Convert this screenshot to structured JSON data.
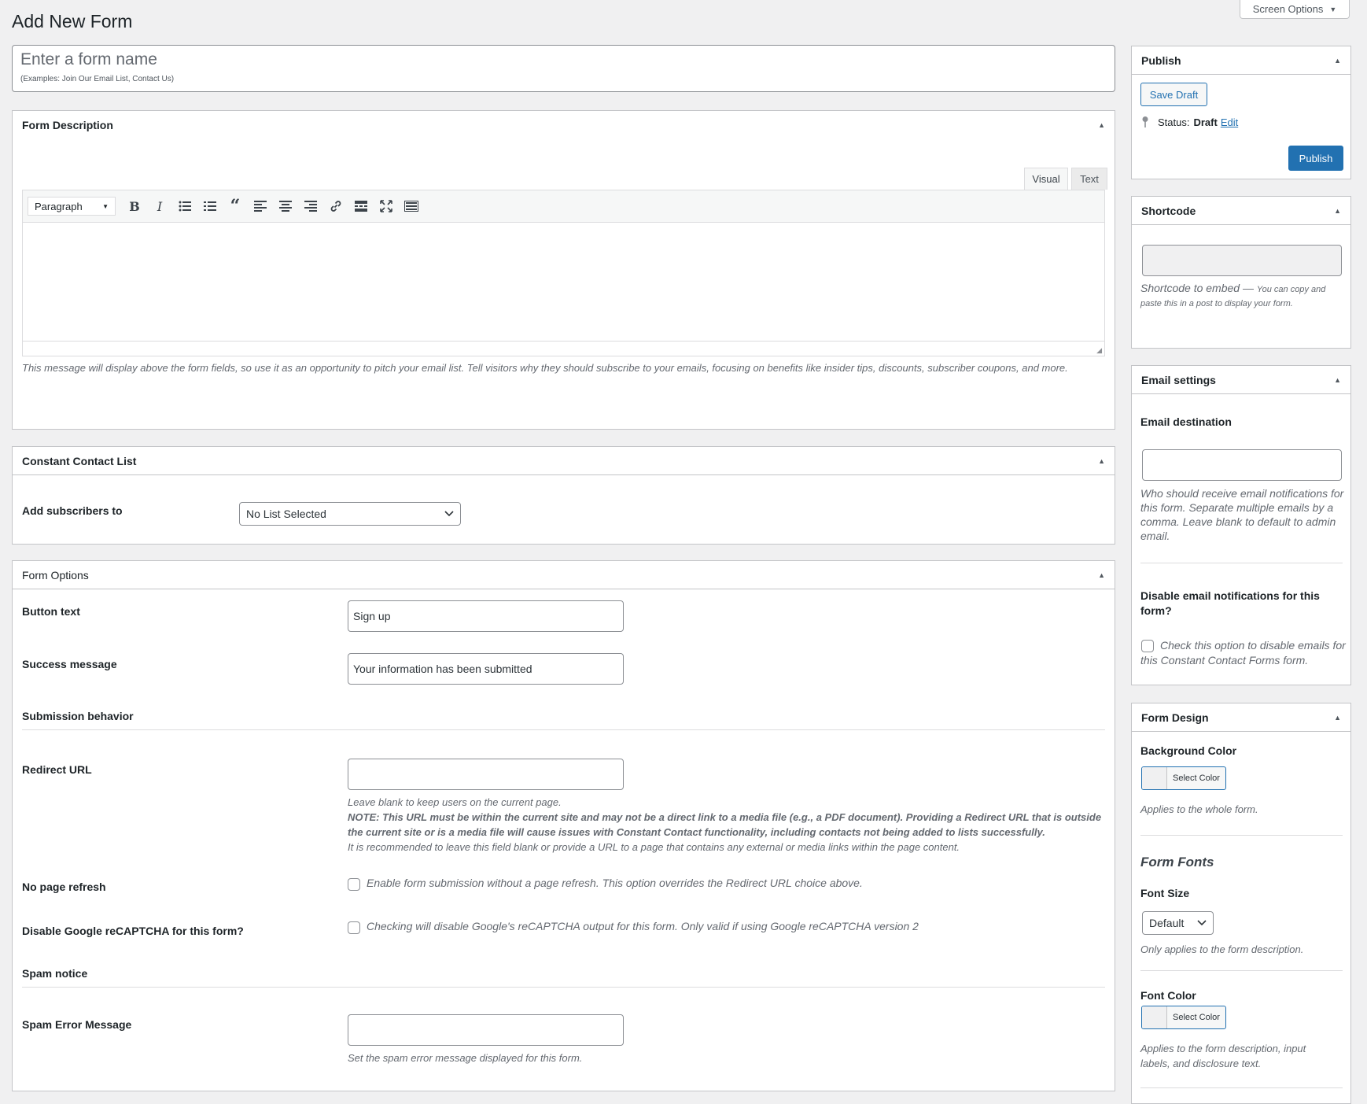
{
  "page": {
    "title": "Add New Form",
    "screen_options": "Screen Options"
  },
  "form_name": {
    "placeholder": "Enter a form name",
    "hint": "(Examples: Join Our Email List, Contact Us)"
  },
  "description_box": {
    "title": "Form Description",
    "tab_visual": "Visual",
    "tab_text": "Text",
    "format_select": "Paragraph",
    "help": "This message will display above the form fields, so use it as an opportunity to pitch your email list. Tell visitors why they should subscribe to your emails, focusing on benefits like insider tips, discounts, subscriber coupons, and more."
  },
  "list_box": {
    "title": "Constant Contact List",
    "label": "Add subscribers to",
    "select_value": "No List Selected"
  },
  "options_box": {
    "title": "Form Options",
    "button_text_label": "Button text",
    "button_text_value": "Sign up",
    "success_label": "Success message",
    "success_value": "Your information has been submitted",
    "submission_heading": "Submission behavior",
    "redirect_label": "Redirect URL",
    "redirect_help1": "Leave blank to keep users on the current page.",
    "redirect_help2": "NOTE: This URL must be within the current site and may not be a direct link to a media file (e.g., a PDF document). Providing a Redirect URL that is outside the current site or is a media file will cause issues with Constant Contact functionality, including contacts not being added to lists successfully.",
    "redirect_help3": "It is recommended to leave this field blank or provide a URL to a page that contains any external or media links within the page content.",
    "no_refresh_label": "No page refresh",
    "no_refresh_desc": "Enable form submission without a page refresh. This option overrides the Redirect URL choice above.",
    "recaptcha_label": "Disable Google reCAPTCHA for this form?",
    "recaptcha_desc": "Checking will disable Google's reCAPTCHA output for this form. Only valid if using Google reCAPTCHA version 2",
    "spam_heading": "Spam notice",
    "spam_label": "Spam Error Message",
    "spam_help": "Set the spam error message displayed for this form."
  },
  "publish_box": {
    "title": "Publish",
    "save_draft": "Save Draft",
    "status_label": "Status:",
    "status_value": "Draft",
    "edit_link": "Edit",
    "publish_button": "Publish"
  },
  "shortcode_box": {
    "title": "Shortcode",
    "help_lead": "Shortcode to embed — ",
    "help_rest": "You can copy and paste this in a post to display your form."
  },
  "email_box": {
    "title": "Email settings",
    "dest_label": "Email destination",
    "dest_help": "Who should receive email notifications for this form. Separate multiple emails by a comma. Leave blank to default to admin email.",
    "disable_label": "Disable email notifications for this form?",
    "disable_desc": "Check this option to disable emails for this Constant Contact Forms form."
  },
  "design_box": {
    "title": "Form Design",
    "bg_label": "Background Color",
    "select_color": "Select Color",
    "bg_help": "Applies to the whole form.",
    "fonts_heading": "Form Fonts",
    "font_size_label": "Font Size",
    "font_size_value": "Default",
    "font_size_help": "Only applies to the form description.",
    "font_color_label": "Font Color",
    "font_color_help": "Applies to the form description, input labels, and disclosure text."
  },
  "colors": {
    "accent": "#2271b1",
    "border": "#c3c4c7",
    "bg": "#f0f0f1"
  }
}
